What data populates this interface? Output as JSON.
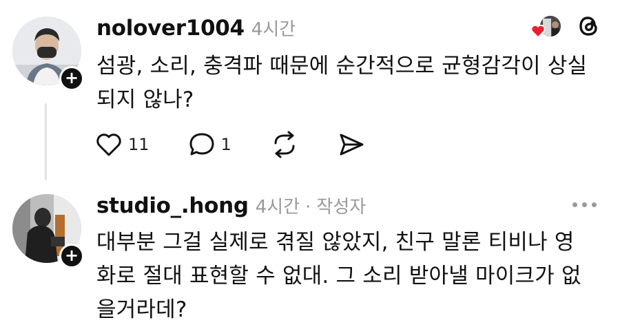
{
  "posts": [
    {
      "username": "nolover1004",
      "time": "4시간",
      "lines": [
        "섬광, 소리, 충격파 때문에 순간적으로 균형감각이 상실",
        "되지 않나?"
      ],
      "likes": "11",
      "replies": "1"
    },
    {
      "username": "studio_.hong",
      "time": "4시간",
      "separator": "·",
      "author_tag": "작성자",
      "lines": [
        "대부분 그걸 실제로 겪질 않았지, 친구 말론 티비나 영",
        "화로 절대 표현할 수 없대. 그 소리 받아낼 마이크가 없",
        "을거라데?"
      ]
    }
  ],
  "icons": {
    "like": "heart-icon",
    "reply": "comment-icon",
    "repost": "repost-icon",
    "share": "send-icon",
    "app": "threads-logo-icon",
    "more": "more-icon",
    "follow": "plus-icon",
    "liked": "red-heart-icon"
  },
  "colors": {
    "text": "#111111",
    "muted": "#999999",
    "liked_heart": "#e8212e"
  }
}
